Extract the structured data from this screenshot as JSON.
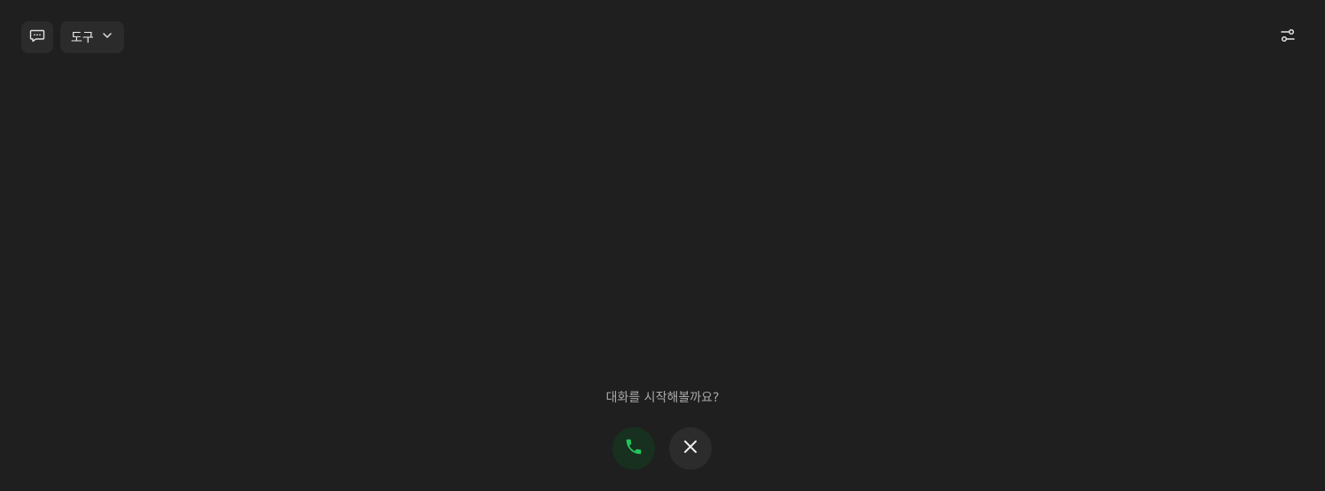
{
  "toolbar": {
    "chat_icon": "chat-bubble-icon",
    "tools_label": "도구",
    "tools_dropdown_icon": "chevron-down-icon",
    "settings_icon": "sliders-icon"
  },
  "main": {
    "prompt_text": "대화를 시작해볼까요?",
    "call_icon": "phone-icon",
    "close_icon": "close-icon"
  },
  "colors": {
    "background": "#1f1f1f",
    "button_bg": "#2b2b2b",
    "accent_green": "#22c55e",
    "call_button_bg": "#17301f"
  }
}
